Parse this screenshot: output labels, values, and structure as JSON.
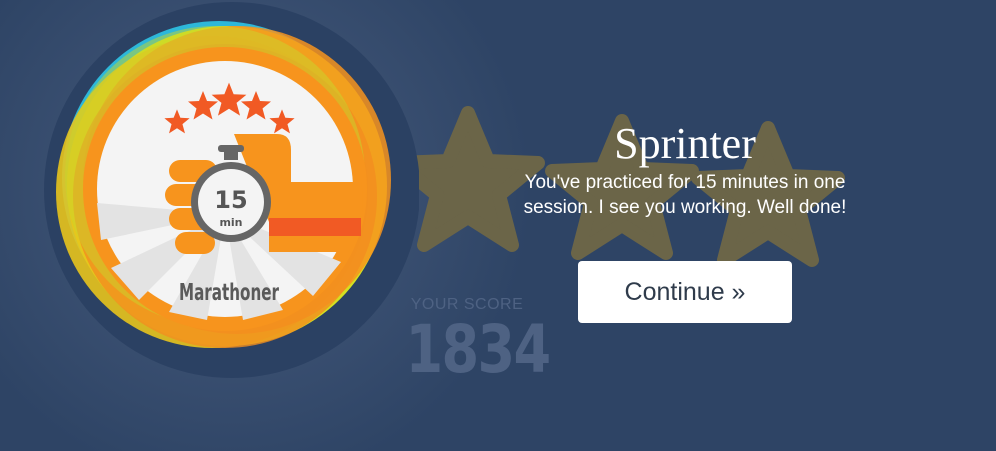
{
  "achievement": {
    "title": "Sprinter",
    "description": "You've practiced for 15 minutes in one session. I see you working. Well done!"
  },
  "badge": {
    "name": "Marathoner",
    "timer_value": "15",
    "timer_unit": "min",
    "stars_count": 5
  },
  "score": {
    "label": "YOUR SCORE",
    "value": "1834"
  },
  "actions": {
    "continue_label": "Continue »"
  },
  "colors": {
    "background": "#2e4465",
    "badge_ring_dark": "#2b4163",
    "badge_orange": "#f7941d",
    "badge_dark_orange": "#f15a24",
    "badge_yellow": "#d4e021",
    "star_muted": "#6b6548",
    "score_text": "#4e6283",
    "button_bg": "#ffffff"
  },
  "icons": {
    "badge_emblem": "stopwatch-in-hand-icon",
    "rating_stars": "star-icon",
    "background_stars": "star-icon"
  }
}
